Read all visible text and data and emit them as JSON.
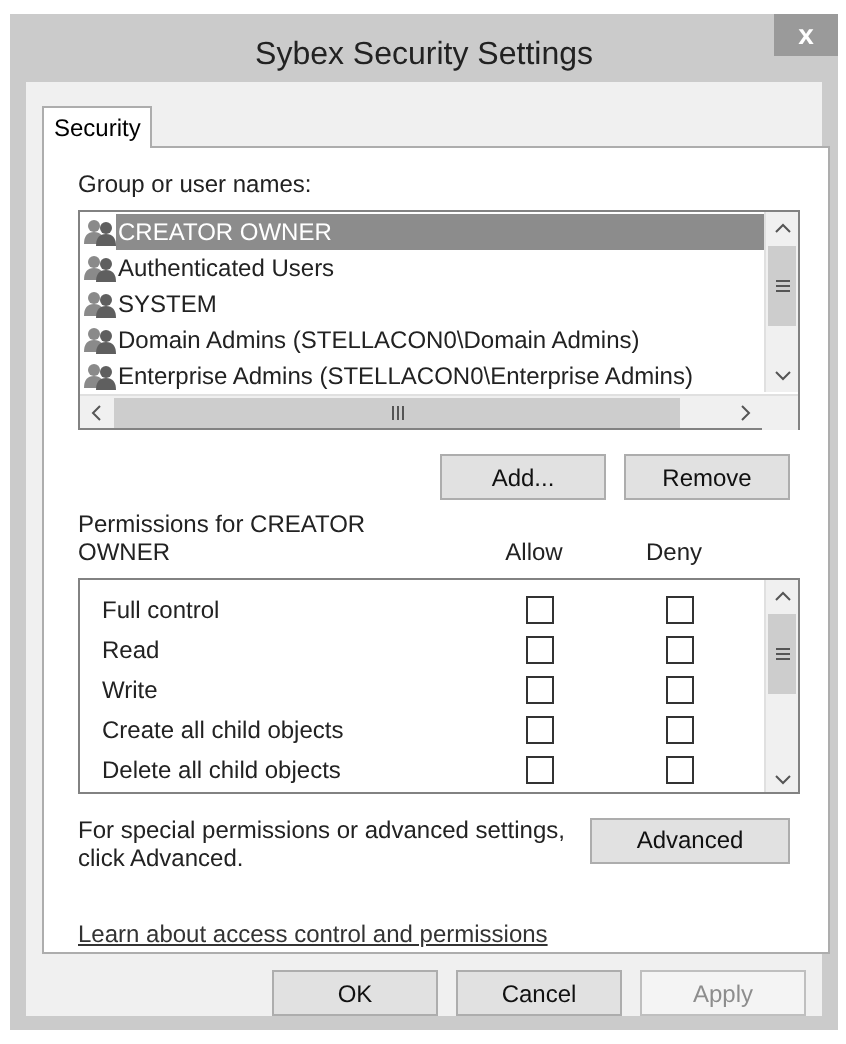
{
  "window": {
    "title": "Sybex Security Settings",
    "close": "x"
  },
  "tabs": [
    {
      "label": "Security",
      "selected": true
    }
  ],
  "users": {
    "label": "Group or user names:",
    "items": [
      {
        "name": "CREATOR OWNER",
        "selected": true
      },
      {
        "name": "Authenticated Users",
        "selected": false
      },
      {
        "name": "SYSTEM",
        "selected": false
      },
      {
        "name": "Domain Admins (STELLACON0\\Domain Admins)",
        "selected": false
      },
      {
        "name": "Enterprise Admins (STELLACON0\\Enterprise Admins)",
        "selected": false
      }
    ]
  },
  "user_buttons": [
    "Add...",
    "Remove"
  ],
  "permissions": {
    "label": "Permissions for CREATOR OWNER",
    "columns": [
      "Allow",
      "Deny"
    ],
    "rows": [
      {
        "name": "Full control",
        "allow": false,
        "deny": false
      },
      {
        "name": "Read",
        "allow": false,
        "deny": false
      },
      {
        "name": "Write",
        "allow": false,
        "deny": false
      },
      {
        "name": "Create all child objects",
        "allow": false,
        "deny": false
      },
      {
        "name": "Delete all child objects",
        "allow": false,
        "deny": false
      }
    ]
  },
  "advanced": {
    "text": "For special permissions or advanced settings, click Advanced.",
    "button": "Advanced"
  },
  "link": "Learn about access control and permissions",
  "buttons": [
    {
      "label": "OK",
      "disabled": false
    },
    {
      "label": "Cancel",
      "disabled": false
    },
    {
      "label": "Apply",
      "disabled": true
    }
  ]
}
